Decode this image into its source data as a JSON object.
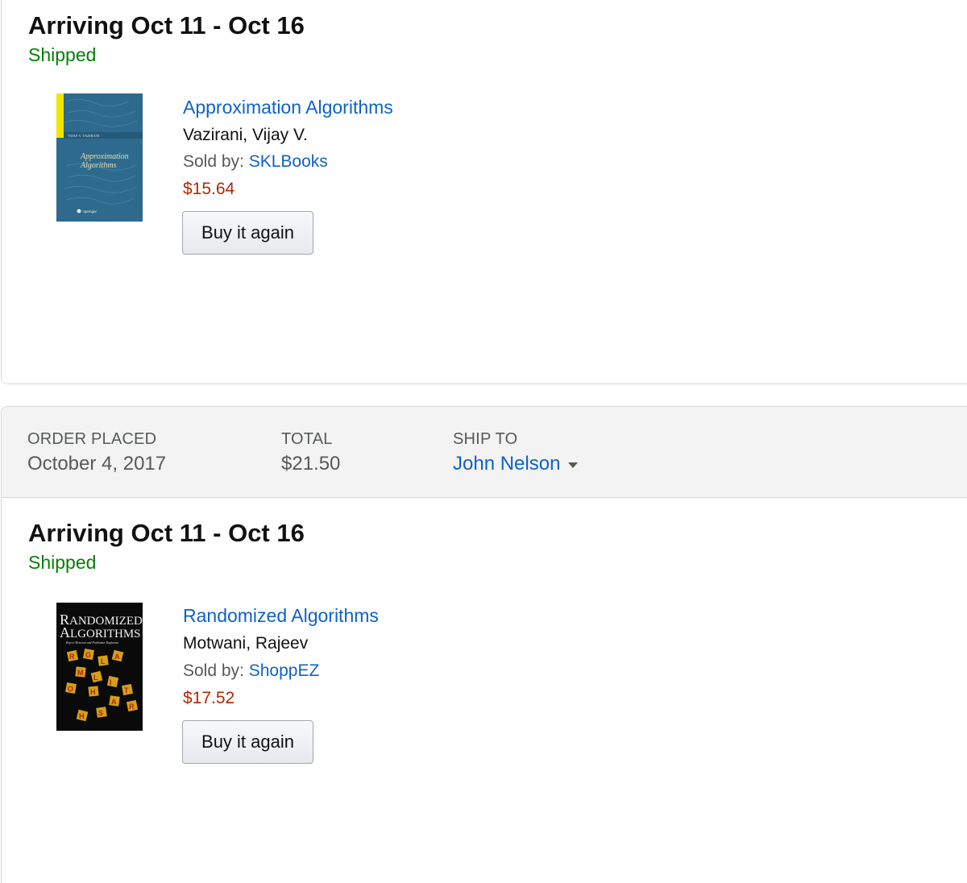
{
  "orders": [
    {
      "shipment": {
        "arriving": "Arriving Oct 11 - Oct 16",
        "status": "Shipped",
        "item": {
          "title": "Approximation Algorithms",
          "author": "Vazirani, Vijay V.",
          "sold_by_label": "Sold by: ",
          "seller": "SKLBooks",
          "price": "$15.64",
          "cover": {
            "line1": "Approximation",
            "line2": "Algorithms",
            "author_small": "VIJAY V. VAZIRANI",
            "publisher": "Springer",
            "colors": {
              "bg": "#2d6a8e",
              "spine": "#f2e600"
            }
          },
          "buy_again_label": "Buy it again"
        }
      }
    },
    {
      "header": {
        "order_placed_label": "ORDER PLACED",
        "order_placed_value": "October 4, 2017",
        "total_label": "TOTAL",
        "total_value": "$21.50",
        "ship_to_label": "SHIP TO",
        "ship_to_value": "John Nelson"
      },
      "shipment": {
        "arriving": "Arriving Oct 11 - Oct 16",
        "status": "Shipped",
        "item": {
          "title": "Randomized Algorithms",
          "author": "Motwani, Rajeev",
          "sold_by_label": "Sold by: ",
          "seller": "ShoppEZ",
          "price": "$17.52",
          "cover": {
            "line1": "RANDOMIZED",
            "line2": "ALGORITHMS",
            "authors_small": "Rajeev Motwani and Prabhakar Raghavan",
            "colors": {
              "bg": "#0a0a0a",
              "tile": "#d4a017",
              "tile_text": "#b3221a"
            }
          },
          "buy_again_label": "Buy it again"
        }
      }
    }
  ],
  "colors": {
    "link": "#0f62c4",
    "shipped": "#067d06",
    "price": "#b12704",
    "header_bg": "#f3f3f3"
  }
}
